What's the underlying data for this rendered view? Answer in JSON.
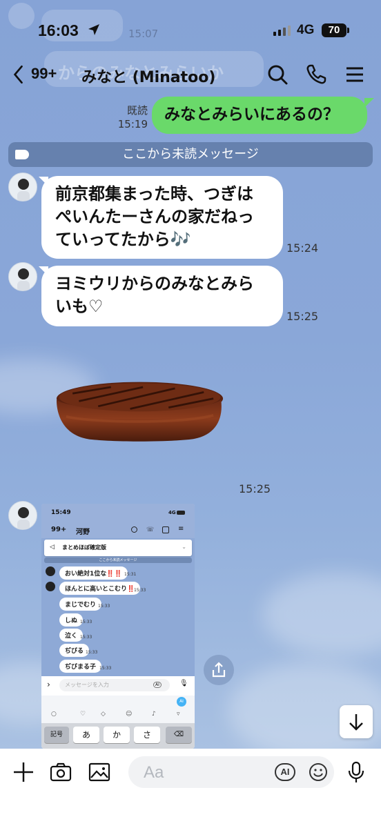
{
  "status_bar": {
    "time": "16:03",
    "network": "4G",
    "battery": "70"
  },
  "ghost_background": {
    "time": "15:07",
    "text": "からのみなとみらいか"
  },
  "header": {
    "back_count": "99+",
    "title": "みなと (Minatoo)"
  },
  "messages": {
    "outgoing_1": {
      "read_label": "既読",
      "time": "15:19",
      "text": "みなとみらいにあるの？"
    },
    "unread_divider": "ここから未読メッセージ",
    "incoming_1": {
      "lines": [
        "前京都集まった時、つぎは",
        "ぺいんたーさんの家だねっ",
        "ていってたから🎶"
      ],
      "time": "15:24"
    },
    "incoming_2": {
      "lines": [
        "ヨミウリからのみなとみら",
        "いも♡"
      ],
      "time": "15:25"
    },
    "image_message": {
      "time": "15:25"
    }
  },
  "embedded_screenshot": {
    "time": "15:49",
    "network": "4G",
    "back_count": "99+",
    "title": "河野",
    "announcement": "まとめほぼ確定版",
    "unread_divider": "ここから未読メッセージ",
    "messages": [
      {
        "text": "おい絶対1位な‼️‼️",
        "time": "15:31",
        "avatar": true
      },
      {
        "text": "ほんとに高いとこむり‼️",
        "time": "15:33",
        "avatar": true
      },
      {
        "text": "まじでむり",
        "time": "15:33",
        "avatar": false
      },
      {
        "text": "しぬ",
        "time": "15:33",
        "avatar": false
      },
      {
        "text": "泣く",
        "time": "15:33",
        "avatar": false
      },
      {
        "text": "ぢびる",
        "time": "15:33",
        "avatar": false
      },
      {
        "text": "ぢびまる子",
        "time": "15:33",
        "avatar": false
      }
    ],
    "input_placeholder": "メッセージを入力",
    "ai_label": "AI",
    "keys": [
      "記号",
      "あ",
      "か",
      "さ"
    ]
  },
  "composer": {
    "placeholder": "Aa",
    "ai_label": "AI"
  },
  "colors": {
    "background": "#8aa6d6",
    "my_bubble": "#6ad96a",
    "their_bubble": "#ffffff",
    "divider": "#4b648c"
  }
}
